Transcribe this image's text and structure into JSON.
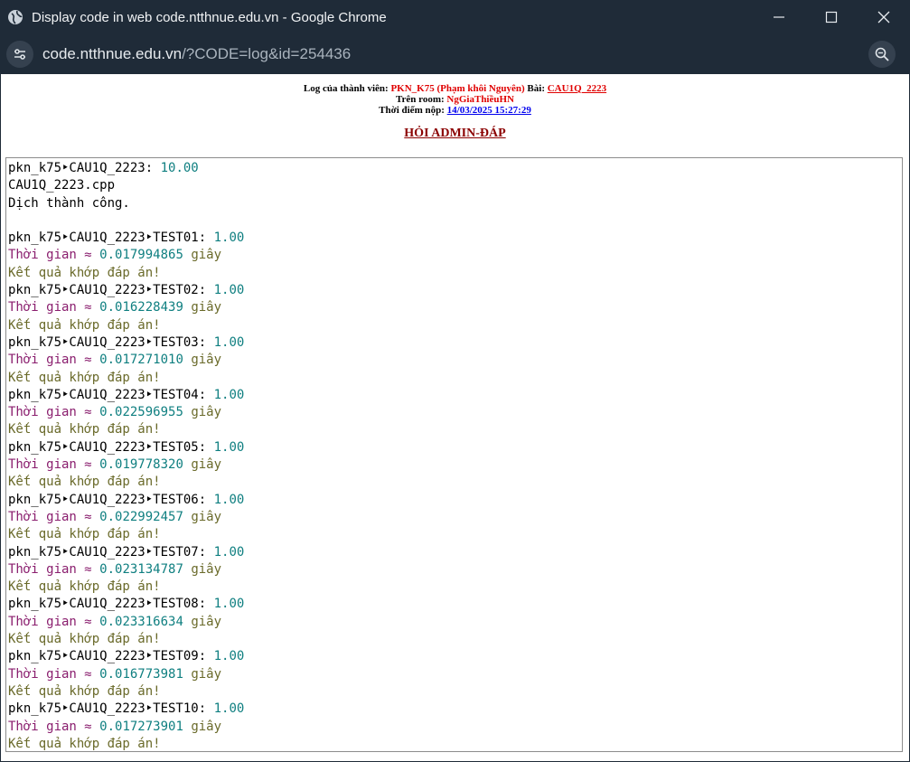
{
  "window": {
    "title": "Display code in web code.ntthnue.edu.vn - Google Chrome"
  },
  "addressbar": {
    "host": "code.ntthnue.edu.vn",
    "path": "/?CODE=log&id=254436"
  },
  "info": {
    "member_label": "Log của thành viên:",
    "member": "PKN_K75 (Phạm khôi Nguyên)",
    "problem_label": "Bài:",
    "problem": "CAU1Q_2223",
    "room_label": "Trên room:",
    "room": "NgGiaThiềuHN",
    "time_label": "Thời điểm nộp:",
    "time": "14/03/2025 15:27:29"
  },
  "ask_link": "HỎI ADMIN-ĐÁP",
  "log": {
    "header_name": "pkn_k75‣CAU1Q_2223:",
    "header_score": "10.00",
    "file": "CAU1Q_2223.cpp",
    "compile": "Dịch thành công.",
    "time_label": "Thời gian ≈",
    "sec_label": "giây",
    "match_label": "Kết quả khớp đáp án!",
    "tests": [
      {
        "name": "pkn_k75‣CAU1Q_2223‣TEST01:",
        "score": "1.00",
        "time": "0.017994865"
      },
      {
        "name": "pkn_k75‣CAU1Q_2223‣TEST02:",
        "score": "1.00",
        "time": "0.016228439"
      },
      {
        "name": "pkn_k75‣CAU1Q_2223‣TEST03:",
        "score": "1.00",
        "time": "0.017271010"
      },
      {
        "name": "pkn_k75‣CAU1Q_2223‣TEST04:",
        "score": "1.00",
        "time": "0.022596955"
      },
      {
        "name": "pkn_k75‣CAU1Q_2223‣TEST05:",
        "score": "1.00",
        "time": "0.019778320"
      },
      {
        "name": "pkn_k75‣CAU1Q_2223‣TEST06:",
        "score": "1.00",
        "time": "0.022992457"
      },
      {
        "name": "pkn_k75‣CAU1Q_2223‣TEST07:",
        "score": "1.00",
        "time": "0.023134787"
      },
      {
        "name": "pkn_k75‣CAU1Q_2223‣TEST08:",
        "score": "1.00",
        "time": "0.023316634"
      },
      {
        "name": "pkn_k75‣CAU1Q_2223‣TEST09:",
        "score": "1.00",
        "time": "0.016773981"
      },
      {
        "name": "pkn_k75‣CAU1Q_2223‣TEST10:",
        "score": "1.00",
        "time": "0.017273901"
      }
    ]
  }
}
